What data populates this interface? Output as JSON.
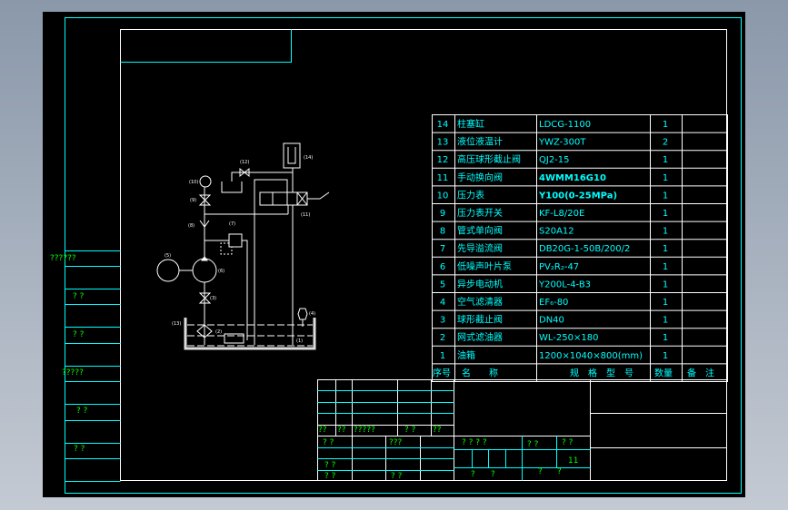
{
  "colors": {
    "background": "#000000",
    "frame": "#00ffff",
    "lines": "#ffffff",
    "text": "#00ffff",
    "unresolved_text": "#00ff00"
  },
  "left_column": [
    "??????",
    "? ?",
    "? ?",
    "?????",
    "? ?",
    "? ?"
  ],
  "parts_table": {
    "header": {
      "no": "序号",
      "name": "名　　称",
      "spec": "规　格　型　号",
      "qty": "数量",
      "note": "备　注"
    },
    "rows": [
      {
        "no": "14",
        "name": "柱塞缸",
        "spec": "LDCG-1100",
        "qty": "1",
        "bold": false
      },
      {
        "no": "13",
        "name": "液位液温计",
        "spec": "YWZ-300T",
        "qty": "2",
        "bold": false
      },
      {
        "no": "12",
        "name": "高压球形截止阀",
        "spec": "QJ2-15",
        "qty": "1",
        "bold": false
      },
      {
        "no": "11",
        "name": "手动换向阀",
        "spec": "4WMM16G10",
        "qty": "1",
        "bold": true
      },
      {
        "no": "10",
        "name": "压力表",
        "spec": "Y100(0-25MPa)",
        "qty": "1",
        "bold": true
      },
      {
        "no": "9",
        "name": "压力表开关",
        "spec": "KF-L8/20E",
        "qty": "1",
        "bold": false
      },
      {
        "no": "8",
        "name": "管式单向阀",
        "spec": "S20A12",
        "qty": "1",
        "bold": false
      },
      {
        "no": "7",
        "name": "先导溢流阀",
        "spec": "DB20G-1-50B/200/2",
        "qty": "1",
        "bold": false
      },
      {
        "no": "6",
        "name": "低噪声叶片泵",
        "spec": "PV₂R₂-47",
        "qty": "1",
        "bold": false
      },
      {
        "no": "5",
        "name": "异步电动机",
        "spec": "Y200L-4-B3",
        "qty": "1",
        "bold": false
      },
      {
        "no": "4",
        "name": "空气滤清器",
        "spec": "EF₆-80",
        "qty": "1",
        "bold": false
      },
      {
        "no": "3",
        "name": "球形截止阀",
        "spec": "DN40",
        "qty": "1",
        "bold": false
      },
      {
        "no": "2",
        "name": "网式滤油器",
        "spec": "WL-250×180",
        "qty": "1",
        "bold": false
      },
      {
        "no": "1",
        "name": "油箱",
        "spec": "1200×1040×800(mm)",
        "qty": "1",
        "bold": false
      }
    ]
  },
  "title_block": {
    "row_a": [
      "??",
      "??",
      "?????",
      "? ?",
      "??"
    ],
    "left_lower": [
      "? ?",
      "???",
      "? ?",
      "? ?",
      "? ?"
    ],
    "mid": [
      "? ? ? ?",
      "? ?",
      "? ?",
      "11",
      "?",
      "?",
      "?",
      "?"
    ]
  },
  "schematic_labels": [
    "(14)",
    "(12)",
    "(10)",
    "(9)",
    "(8)",
    "(7)",
    "(5)",
    "(6)",
    "(3)",
    "(13)",
    "(2)",
    "(4)",
    "(1)",
    "(11)"
  ]
}
